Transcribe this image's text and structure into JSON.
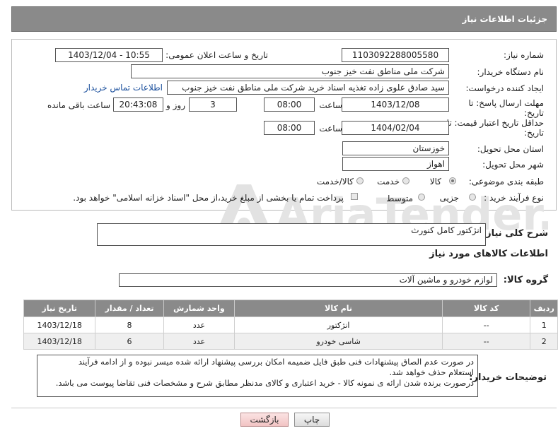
{
  "header": {
    "title": "جزئیات اطلاعات نیاز"
  },
  "form": {
    "need_number": {
      "label": "شماره نیاز:",
      "value": "1103092288005580"
    },
    "announce_datetime": {
      "label": "تاریخ و ساعت اعلان عمومی:",
      "value": "1403/12/04 - 10:55"
    },
    "buyer_org": {
      "label": "نام دستگاه خریدار:",
      "value": "شرکت ملی مناطق نفت خیز جنوب"
    },
    "requester": {
      "label": "ایجاد کننده درخواست:",
      "value": "سید صادق علوی زاده  تغذیه اسناد خرید  شرکت ملی مناطق نفت خیز جنوب",
      "contact_link": "اطلاعات تماس خریدار"
    },
    "response_deadline": {
      "label_line1": "مهلت ارسال پاسخ: تا",
      "label_line2": "تاریخ:",
      "date": "1403/12/08",
      "time_label": "ساعت",
      "time": "08:00",
      "days": "3",
      "days_label": "روز و",
      "remaining": "20:43:08",
      "remaining_label": "ساعت باقی مانده"
    },
    "price_validity": {
      "label_line1": "حداقل تاریخ اعتبار قیمت: تا",
      "label_line2": "تاریخ:",
      "date": "1404/02/04",
      "time_label": "ساعت",
      "time": "08:00"
    },
    "delivery_province": {
      "label": "استان محل تحویل:",
      "value": "خوزستان"
    },
    "delivery_city": {
      "label": "شهر محل تحویل:",
      "value": "اهواز"
    },
    "category": {
      "label": "طبقه بندی موضوعی:",
      "options": [
        "کالا",
        "خدمت",
        "کالا/خدمت"
      ],
      "selected": "کالا"
    },
    "purchase_process": {
      "label": "نوع فرآیند خرید :",
      "options": [
        "جزیی",
        "متوسط"
      ],
      "selected": "متوسط",
      "payment_note": "پرداخت تمام یا بخشی از مبلغ خرید،از محل \"اسناد خزانه اسلامی\" خواهد بود."
    }
  },
  "summary": {
    "label": "شرح کلی نیاز:",
    "value": "انژکتور کامل کنورث"
  },
  "goods_section": {
    "title": "اطلاعات کالاهای مورد نیاز"
  },
  "goods_group": {
    "label": "گروه کالا:",
    "value": "لوازم خودرو و ماشین آلات"
  },
  "table": {
    "headers": [
      "ردیف",
      "کد کالا",
      "نام کالا",
      "واحد شمارش",
      "تعداد / مقدار",
      "تاریخ نیاز"
    ],
    "rows": [
      [
        "1",
        "--",
        "انژکتور",
        "عدد",
        "8",
        "1403/12/18"
      ],
      [
        "2",
        "--",
        "شاسی خودرو",
        "عدد",
        "6",
        "1403/12/18"
      ]
    ]
  },
  "buyer_notes": {
    "label": "توضیحات خریدار:",
    "lines": [
      "در صورت عدم الصاق پیشنهادات فنی طبق فایل ضمیمه امکان بررسی پیشنهاد ارائه شده میسر نبوده و از ادامه فرآیند",
      "استعلام حذف خواهد شد.",
      "درصورت برنده شدن ارائه ی نمونه کالا - خرید اعتباری و کالای مدنظر مطابق شرح و مشخصات فنی تقاضا پیوست می باشد."
    ]
  },
  "buttons": {
    "print": "چاپ",
    "back": "بازگشت"
  },
  "watermark": {
    "text": "AriaTender.net"
  }
}
